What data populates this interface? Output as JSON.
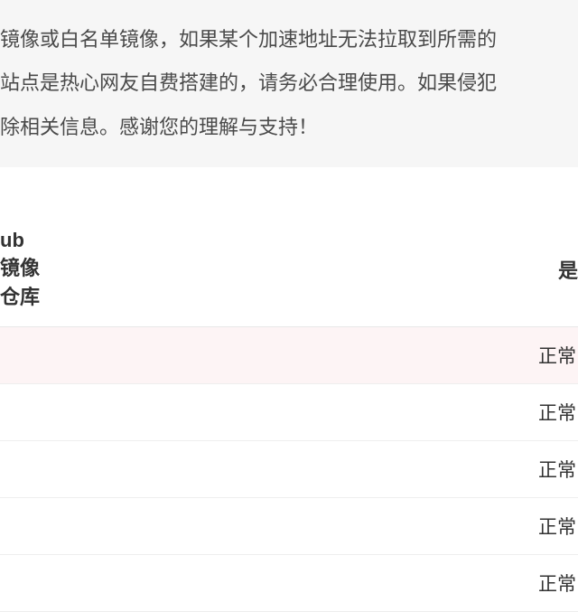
{
  "notice": {
    "line1": "镜像或白名单镜像，如果某个加速地址无法拉取到所需的",
    "line2": "站点是热心网友自费搭建的，请务必合理使用。如果侵犯",
    "line3": "除相关信息。感谢您的理解与支持！"
  },
  "table": {
    "headers": {
      "col1": "ub 镜像仓库",
      "col2": "是"
    },
    "rows": [
      {
        "repo": "",
        "status": "正常"
      },
      {
        "repo": "",
        "status": "正常"
      },
      {
        "repo": "",
        "status": "正常"
      },
      {
        "repo": "",
        "status": "正常"
      },
      {
        "repo": "",
        "status": "正常"
      }
    ]
  }
}
